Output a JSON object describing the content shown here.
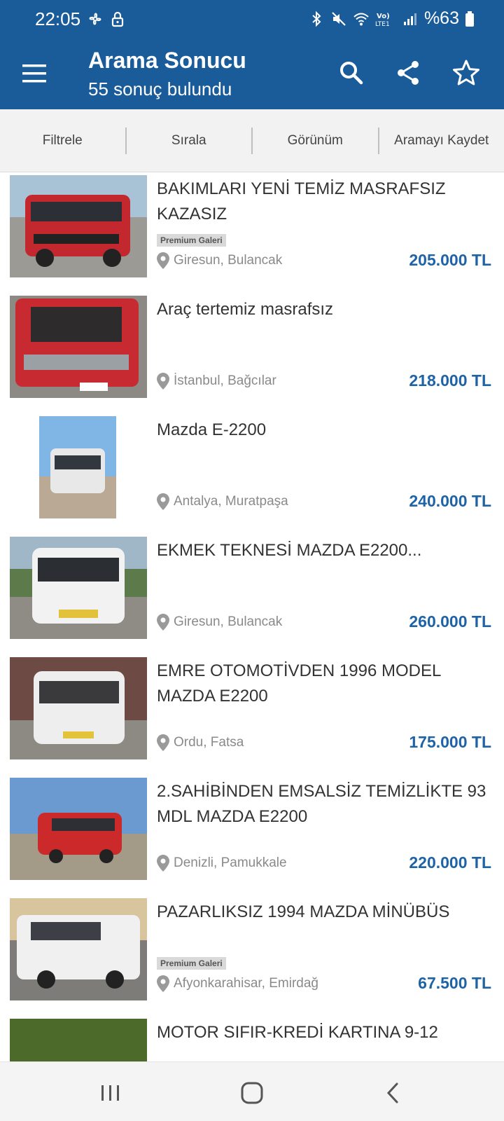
{
  "status_bar": {
    "time": "22:05",
    "battery": "%63",
    "icons": [
      "fan-icon",
      "lock-icon",
      "bluetooth-icon",
      "mute-icon",
      "wifi-icon",
      "volte-icon",
      "signal-icon",
      "battery-icon"
    ]
  },
  "app_bar": {
    "title": "Arama Sonucu",
    "subtitle": "55 sonuç bulundu",
    "icons": [
      "menu-icon",
      "search-icon",
      "share-icon",
      "star-icon"
    ],
    "color": "#1a5b99"
  },
  "filter_bar": {
    "items": [
      "Filtrele",
      "Sırala",
      "Görünüm",
      "Aramayı Kaydet"
    ]
  },
  "listings": [
    {
      "title": "BAKIMLARI YENİ TEMİZ MASRAFSIZ KAZASIZ",
      "badge": "Premium Galeri",
      "location": "Giresun, Bulancak",
      "price": "205.000 TL",
      "van_color": "#c4282f"
    },
    {
      "title": "Araç tertemiz masrafsız",
      "badge": "",
      "location": "İstanbul, Bağcılar",
      "price": "218.000 TL",
      "van_color": "#c72a30"
    },
    {
      "title": "Mazda E-2200",
      "badge": "",
      "location": "Antalya, Muratpaşa",
      "price": "240.000 TL",
      "van_color": "#e8e8e8"
    },
    {
      "title": "EKMEK TEKNESİ MAZDA E2200...",
      "badge": "",
      "location": "Giresun, Bulancak",
      "price": "260.000 TL",
      "van_color": "#f2f2f2"
    },
    {
      "title": "EMRE OTOMOTİVDEN 1996 MODEL MAZDA E2200",
      "badge": "",
      "location": "Ordu, Fatsa",
      "price": "175.000 TL",
      "van_color": "#eeeeee"
    },
    {
      "title": "2.SAHİBİNDEN EMSALSİZ TEMİZLİKTE 93 MDL MAZDA E2200",
      "badge": "",
      "location": "Denizli, Pamukkale",
      "price": "220.000 TL",
      "van_color": "#cc2a2a"
    },
    {
      "title": "PAZARLIKSIZ 1994 MAZDA MİNÜBÜS",
      "badge": "Premium Galeri",
      "location": "Afyonkarahisar, Emirdağ",
      "price": "67.500 TL",
      "van_color": "#f0f0f0"
    },
    {
      "title": "MOTOR SIFIR-KREDİ KARTINA 9-12",
      "badge": "",
      "location": "",
      "price": "",
      "van_color": "#4c6a2a"
    }
  ],
  "nav_bar": {
    "icons": [
      "recents-icon",
      "home-icon",
      "back-icon"
    ]
  },
  "colors": {
    "accent": "#1a5b99",
    "price": "#1e63a8"
  }
}
